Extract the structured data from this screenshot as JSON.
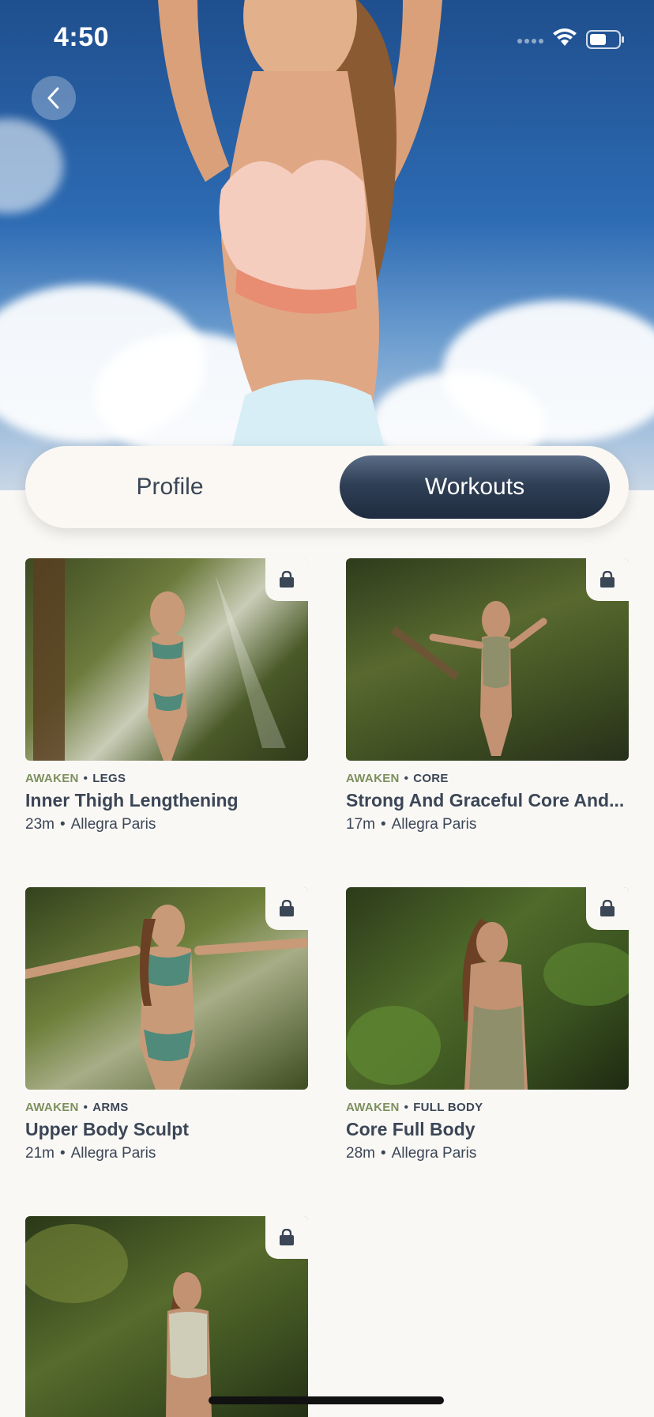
{
  "status_bar": {
    "time": "4:50"
  },
  "segmented": {
    "profile_label": "Profile",
    "workouts_label": "Workouts",
    "selected": "Workouts"
  },
  "workouts": [
    {
      "program": "AWAKEN",
      "category": "LEGS",
      "title": "Inner Thigh Lengthening",
      "duration": "23m",
      "instructor": "Allegra Paris"
    },
    {
      "program": "AWAKEN",
      "category": "CORE",
      "title": "Strong And Graceful Core And...",
      "duration": "17m",
      "instructor": "Allegra Paris"
    },
    {
      "program": "AWAKEN",
      "category": "ARMS",
      "title": "Upper Body Sculpt",
      "duration": "21m",
      "instructor": "Allegra Paris"
    },
    {
      "program": "AWAKEN",
      "category": "FULL BODY",
      "title": "Core Full Body",
      "duration": "28m",
      "instructor": "Allegra Paris"
    }
  ],
  "icons": {
    "back": "chevron-left-icon",
    "lock": "lock-icon",
    "wifi": "wifi-icon",
    "battery": "battery-icon"
  },
  "colors": {
    "accent": "#2f3f56",
    "program": "#7c8f5d",
    "background": "#faf8f5"
  }
}
